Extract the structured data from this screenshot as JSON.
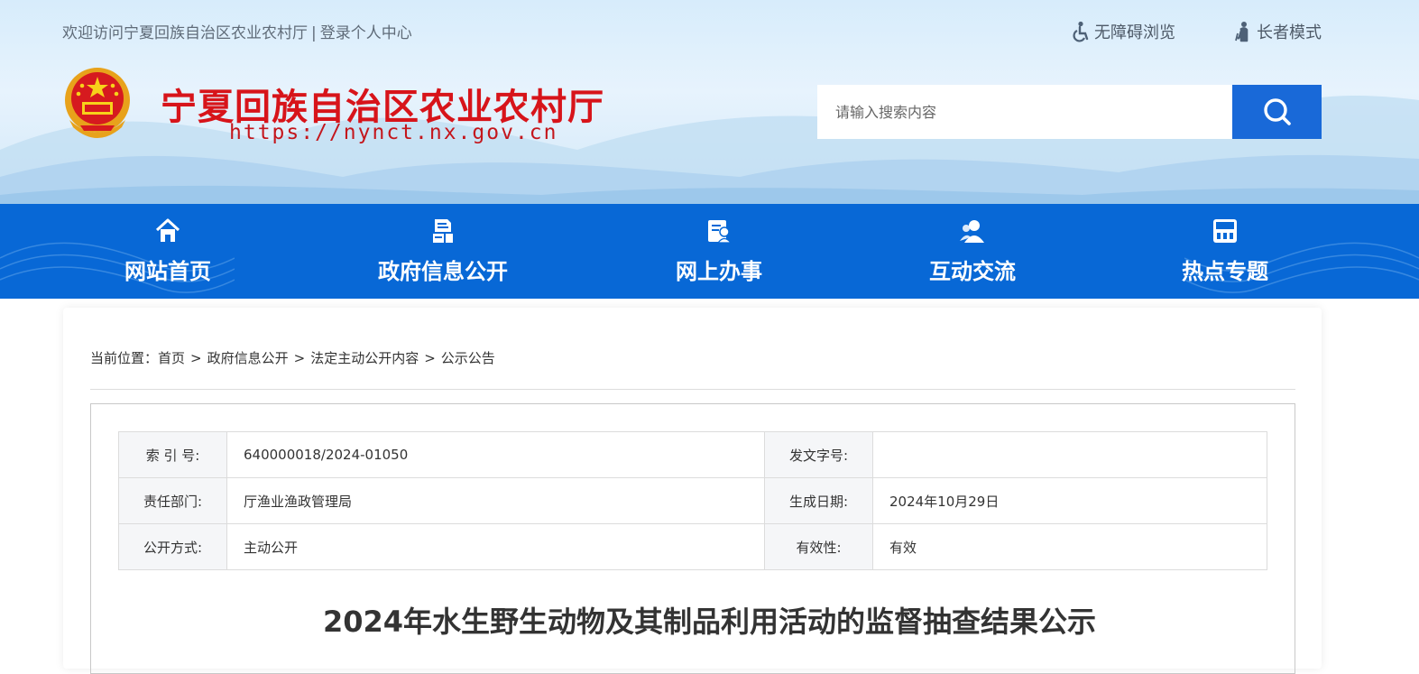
{
  "header": {
    "welcome_text": "欢迎访问宁夏回族自治区农业农村厅",
    "login_link": "登录个人中心",
    "separator": "|",
    "accessibility_link": "无障碍浏览",
    "elder_mode_link": "长者模式",
    "site_title": "宁夏回族自治区农业农村厅",
    "site_url": "https://nynct.nx.gov.cn",
    "search_placeholder": "请输入搜索内容"
  },
  "nav": {
    "items": [
      {
        "label": "网站首页",
        "icon": "home-icon"
      },
      {
        "label": "政府信息公开",
        "icon": "document-icon"
      },
      {
        "label": "网上办事",
        "icon": "service-icon"
      },
      {
        "label": "互动交流",
        "icon": "users-icon"
      },
      {
        "label": "热点专题",
        "icon": "topic-icon"
      }
    ]
  },
  "breadcrumb": {
    "prefix": "当前位置：",
    "items": [
      "首页",
      "政府信息公开",
      "法定主动公开内容",
      "公示公告"
    ],
    "separator": ">"
  },
  "meta": {
    "index_label": "索 引 号:",
    "index_value": "640000018/2024-01050",
    "doc_no_label": "发文字号:",
    "doc_no_value": "",
    "dept_label": "责任部门:",
    "dept_value": "厅渔业渔政管理局",
    "date_label": "生成日期:",
    "date_value": "2024年10月29日",
    "publish_label": "公开方式:",
    "publish_value": "主动公开",
    "validity_label": "有效性:",
    "validity_value": "有效"
  },
  "document": {
    "title": "2024年水生野生动物及其制品利用活动的监督抽查结果公示"
  },
  "colors": {
    "brand_red": "#d7141a",
    "nav_blue": "#0868d6",
    "search_blue": "#1969d8"
  }
}
